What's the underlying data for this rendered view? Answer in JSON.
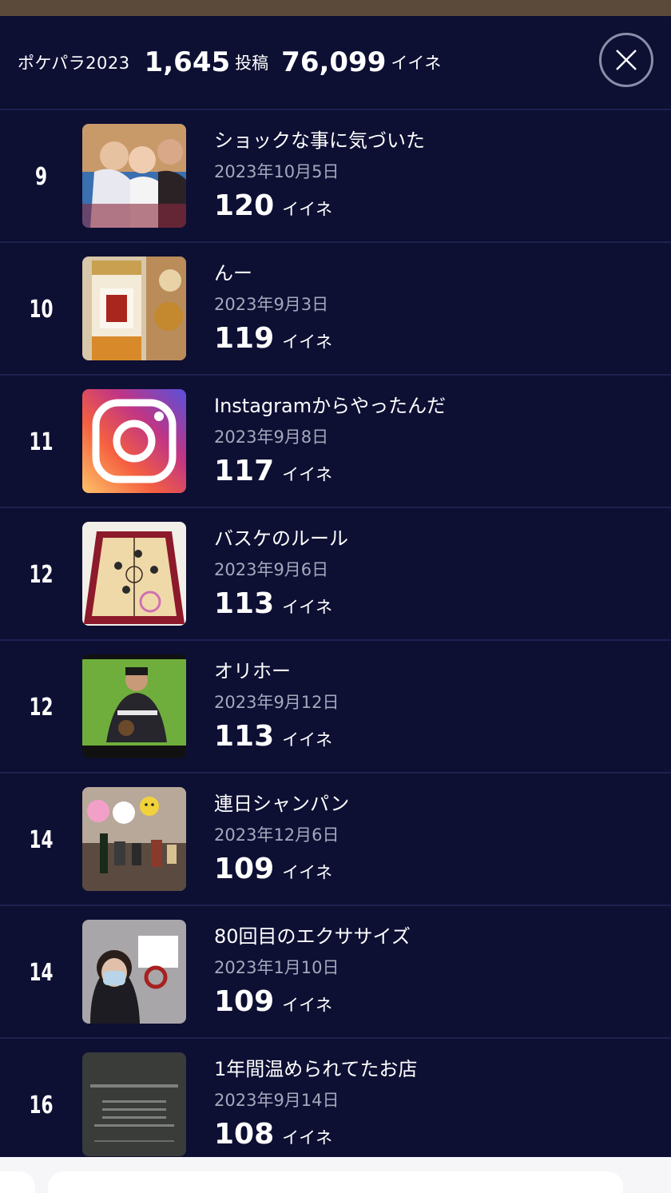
{
  "header": {
    "app_title": "ポケパラ2023",
    "posts_count": "1,645",
    "posts_unit": "投稿",
    "likes_count": "76,099",
    "likes_unit": "イイネ"
  },
  "colors": {
    "background": "#0d0f33",
    "divider": "#1d2150",
    "top_strip": "#5b4a3a",
    "date_text": "#a6a8bd"
  },
  "like_unit": "イイネ",
  "rows": [
    {
      "rank": "9",
      "title": "ショックな事に気づいた",
      "date": "2023年10月5日",
      "likes": "120",
      "thumb": "photo-three-women"
    },
    {
      "rank": "10",
      "title": "んー",
      "date": "2023年9月3日",
      "likes": "119",
      "thumb": "photo-drink-can-aki-aji"
    },
    {
      "rank": "11",
      "title": "Instagramからやったんだ",
      "date": "2023年9月8日",
      "likes": "117",
      "thumb": "instagram-logo"
    },
    {
      "rank": "12",
      "title": "バスケのルール",
      "date": "2023年9月6日",
      "likes": "113",
      "thumb": "basketball-court-diagram"
    },
    {
      "rank": "12",
      "title": "オリホー",
      "date": "2023年9月12日",
      "likes": "113",
      "thumb": "photo-baseball-player"
    },
    {
      "rank": "14",
      "title": "連日シャンパン",
      "date": "2023年12月6日",
      "likes": "109",
      "thumb": "photo-champagne-party"
    },
    {
      "rank": "14",
      "title": "80回目のエクササイズ",
      "date": "2023年1月10日",
      "likes": "109",
      "thumb": "photo-selfie-mask"
    },
    {
      "rank": "16",
      "title": "1年間温められてたお店",
      "date": "2023年9月14日",
      "likes": "108",
      "thumb": "photo-record-sleeve"
    }
  ]
}
